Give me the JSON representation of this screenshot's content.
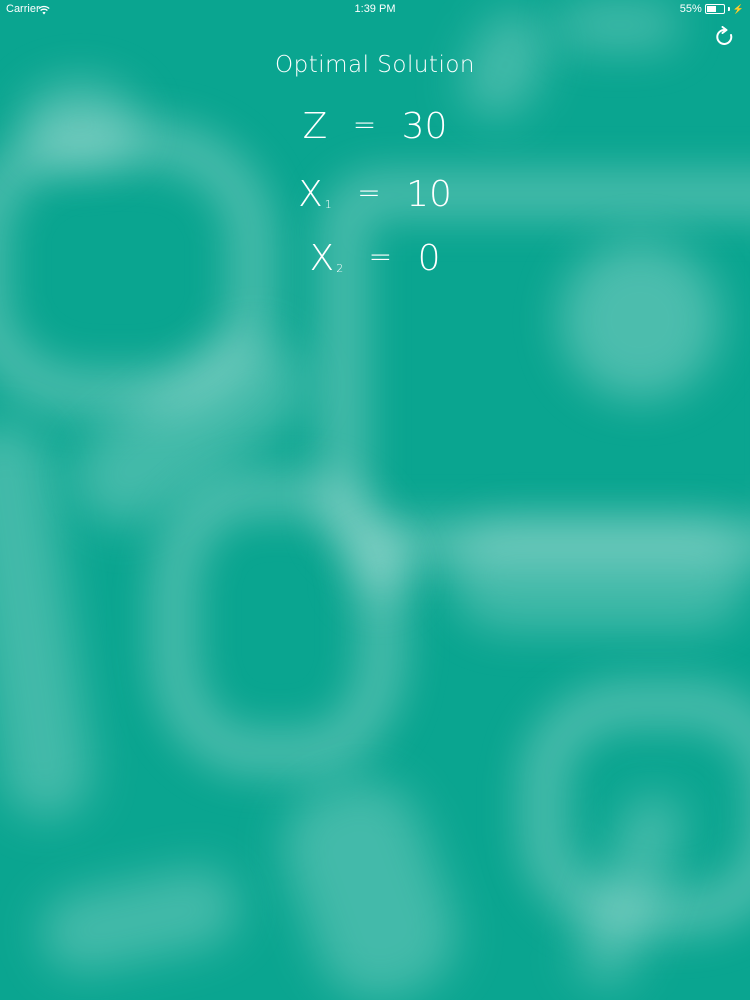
{
  "status_bar": {
    "carrier": "Carrier",
    "time": "1:39 PM",
    "battery_text": "55%",
    "battery_level": 0.55
  },
  "toolbar": {
    "refresh_icon": "refresh-icon"
  },
  "solution": {
    "title": "Optimal Solution",
    "equals": "=",
    "z_var": "Z",
    "z_value": "30",
    "x1_var": "X",
    "x1_sub": "1",
    "x1_value": "10",
    "x2_var": "X",
    "x2_sub": "2",
    "x2_value": "0"
  },
  "colors": {
    "background": "#0aa590",
    "text": "#ffffff"
  }
}
